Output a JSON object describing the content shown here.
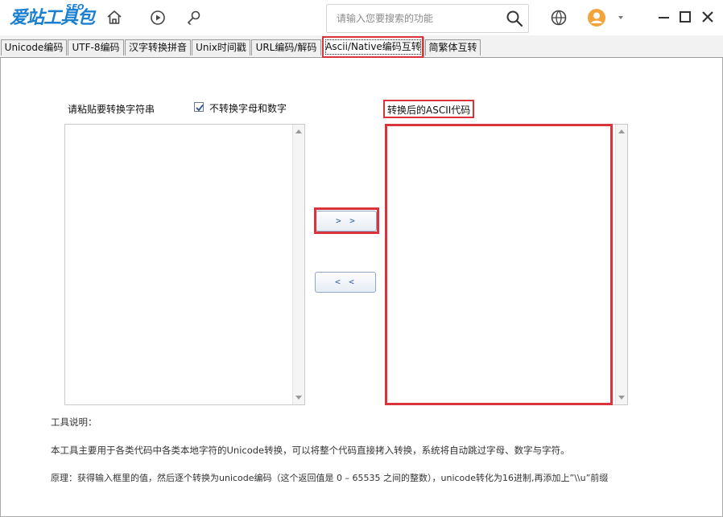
{
  "app": {
    "logo_text": "爱站工具包",
    "logo_seo": "SEO",
    "search_placeholder": "请输入您要搜索的功能"
  },
  "nav_icons": [
    "home-icon",
    "play-icon",
    "tools-icon"
  ],
  "header_icons": [
    "basketball-icon",
    "user-avatar-icon",
    "dropdown-arrow-icon"
  ],
  "window_controls": [
    "minimize-icon",
    "maximize-icon",
    "close-icon"
  ],
  "tabs": [
    {
      "label": "Unicode编码",
      "active": false
    },
    {
      "label": "UTF-8编码",
      "active": false
    },
    {
      "label": "汉字转换拼音",
      "active": false
    },
    {
      "label": "Unix时间戳",
      "active": false
    },
    {
      "label": "URL编码/解码",
      "active": false
    },
    {
      "label": "Ascii/Native编码互转",
      "active": true
    },
    {
      "label": "简繁体互转",
      "active": false
    }
  ],
  "converter": {
    "input_label": "请粘贴要转换字符串",
    "checkbox_label": "不转换字母和数字",
    "checkbox_checked": true,
    "output_label": "转换后的ASCII代码",
    "input_value": "",
    "output_value": "",
    "forward_button": "> >",
    "backward_button": "< <"
  },
  "description": {
    "title": "工具说明：",
    "line1": "本工具主要用于各类代码中各类本地字符的Unicode转换，可以将整个代码直接拷入转换，系统将自动跳过字母、数字与字符。",
    "line2": "原理：获得输入框里的值，然后逐个转换为unicode编码（这个返回值是 0 – 65535 之间的整数），unicode转化为16进制,再添加上”\\\\u”前缀"
  },
  "colors": {
    "brand": "#1a7fd1",
    "highlight": "#d9343b",
    "button_text": "#2a5db0"
  }
}
